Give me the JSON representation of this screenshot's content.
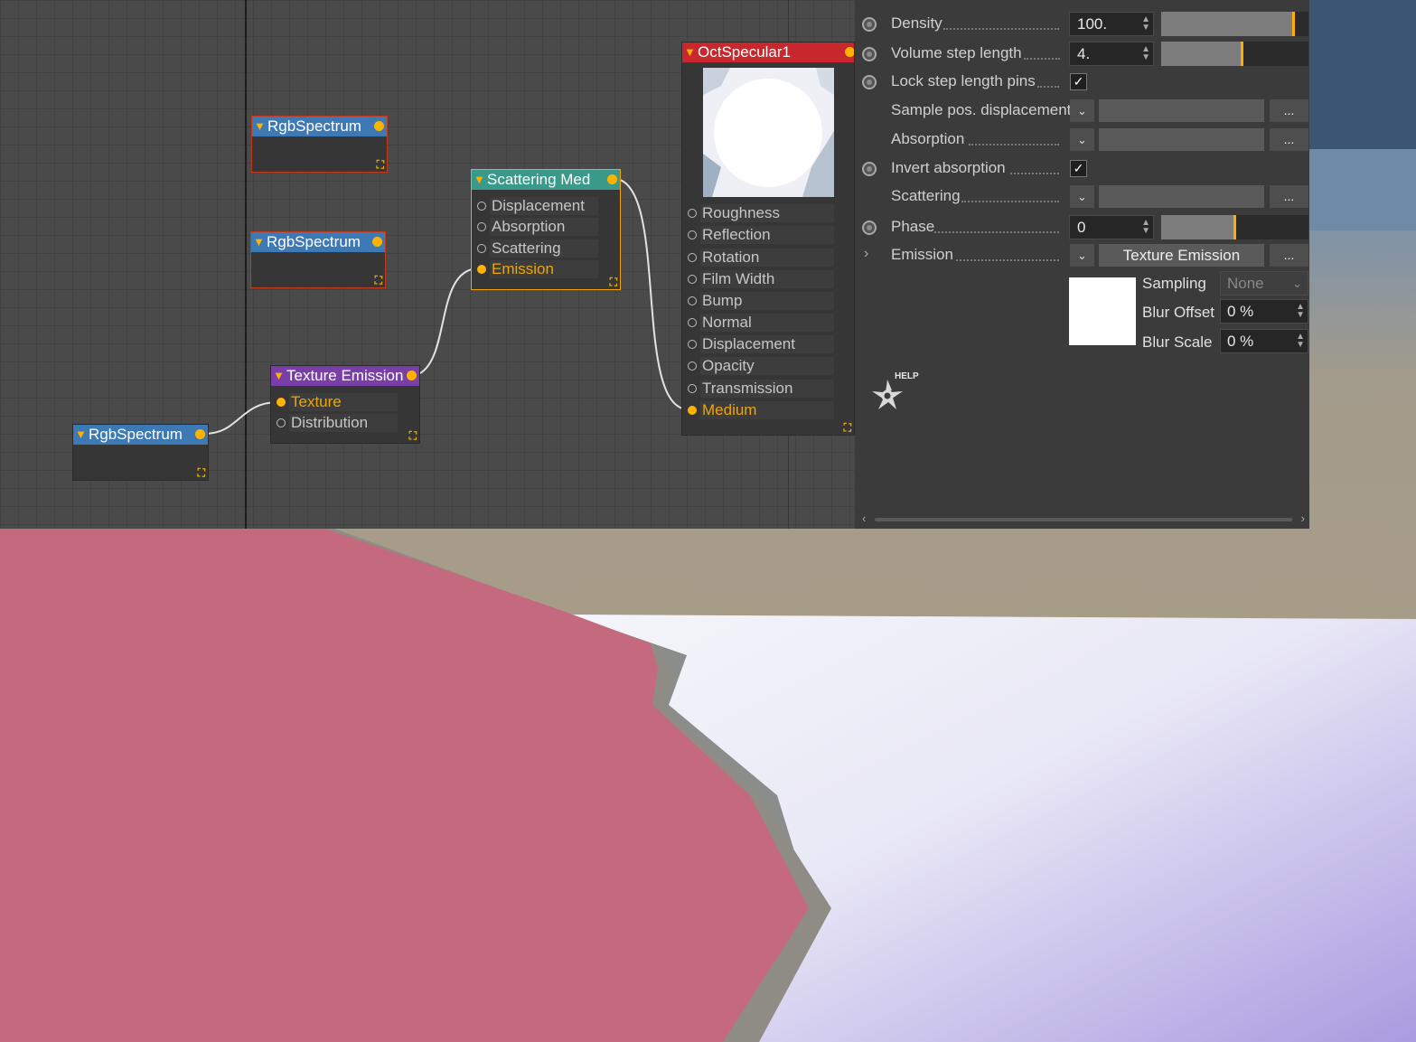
{
  "nodes": {
    "rgb1": {
      "title": "RgbSpectrum"
    },
    "rgb2": {
      "title": "RgbSpectrum"
    },
    "rgb3": {
      "title": "RgbSpectrum"
    },
    "texture_emission": {
      "title": "Texture Emission",
      "pins": [
        "Texture",
        "Distribution"
      ]
    },
    "scattering": {
      "title": "Scattering Med",
      "pins": [
        "Displacement",
        "Absorption",
        "Scattering",
        "Emission"
      ]
    },
    "specular": {
      "title": "OctSpecular1",
      "pins": [
        "Roughness",
        "Reflection",
        "Rotation",
        "Film Width",
        "Bump",
        "Normal",
        "Displacement",
        "Opacity",
        "Transmission",
        "Medium"
      ]
    }
  },
  "inspector": {
    "density": {
      "label": "Density",
      "value": "100.",
      "slider_fraction": 0.9
    },
    "step_length": {
      "label": "Volume step length",
      "value": "4.",
      "slider_fraction": 0.55
    },
    "lock_pins": {
      "label": "Lock step length pins",
      "checked": true,
      "check_glyph": "✓"
    },
    "sample_disp": {
      "label": "Sample pos. displacement",
      "button": "..."
    },
    "absorption": {
      "label": "Absorption",
      "button": "..."
    },
    "invert_abs": {
      "label": "Invert absorption",
      "checked": true,
      "check_glyph": "✓"
    },
    "scattering": {
      "label": "Scattering",
      "button": "..."
    },
    "phase": {
      "label": "Phase",
      "value": "0",
      "slider_fraction": 0.5
    },
    "emission": {
      "label": "Emission",
      "value": "Texture Emission",
      "button": "..."
    },
    "sampling": {
      "label": "Sampling",
      "value": "None"
    },
    "blur_offset": {
      "label": "Blur Offset",
      "value": "0 %"
    },
    "blur_scale": {
      "label": "Blur Scale",
      "value": "0 %"
    },
    "help_label": "HELP"
  },
  "colors": {
    "accent": "#ffb300",
    "rgb_header": "#3d7ab5",
    "texture_header": "#7a3ea8",
    "scattering_header": "#3a9a8a",
    "specular_header": "#c8282d"
  },
  "icons": [
    "collapse-triangle-icon",
    "output-pin-icon",
    "resize-icon",
    "help-octane-icon",
    "chevron-down-icon",
    "chevron-right-icon",
    "checkmark-icon"
  ]
}
